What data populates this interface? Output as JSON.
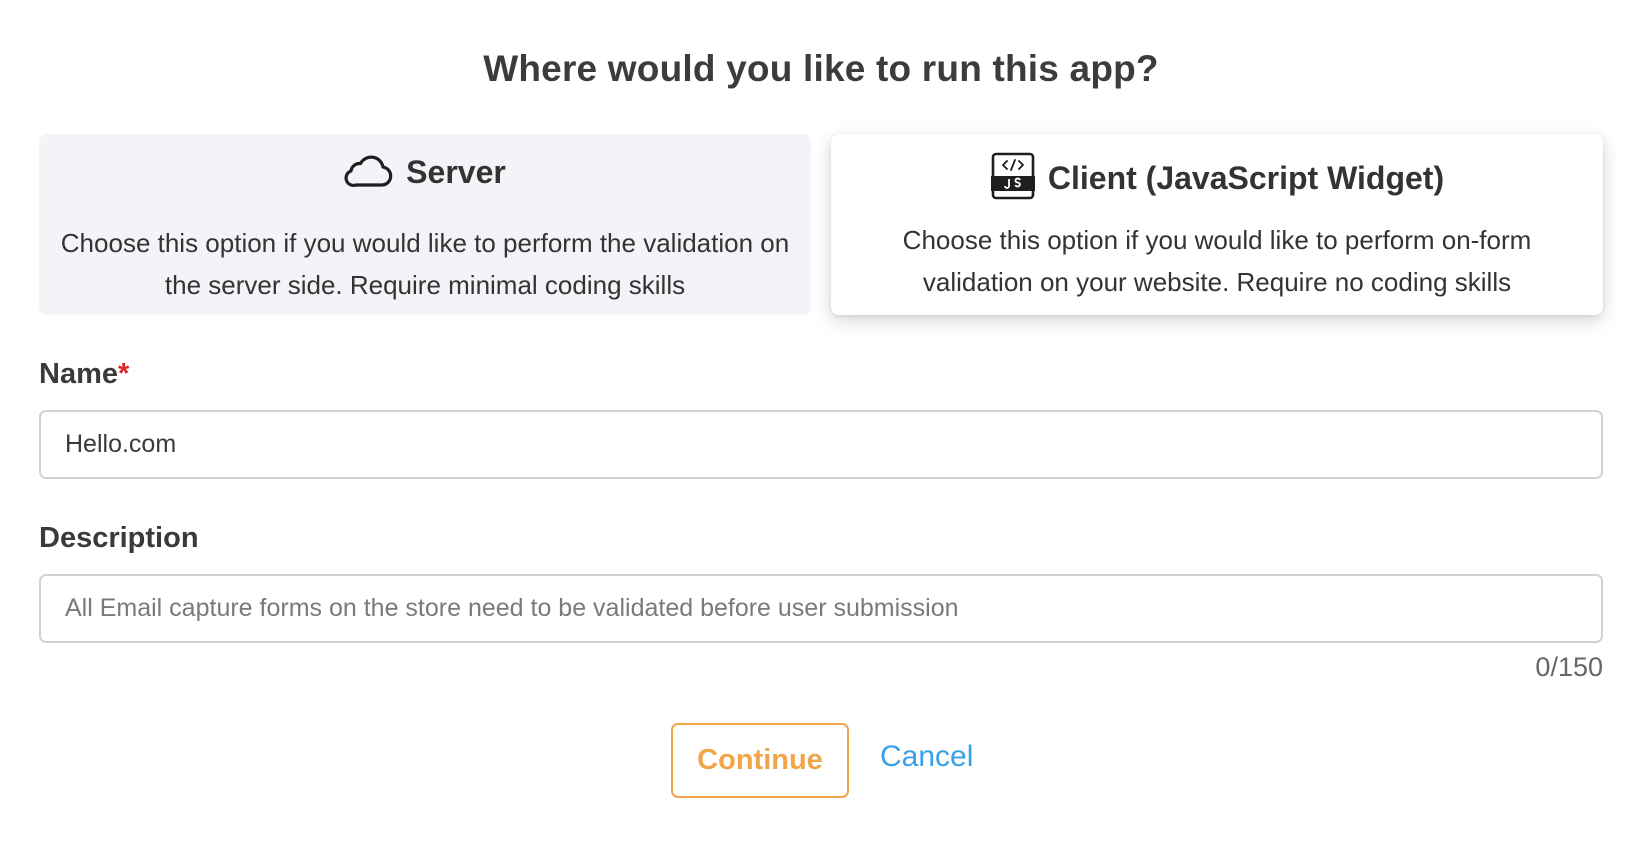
{
  "dialog": {
    "title": "Where would you like to run this app?"
  },
  "options": {
    "server": {
      "icon": "cloud-icon",
      "title": "Server",
      "description": "Choose this option if you would like to perform the validation on the server side. Require minimal coding skills"
    },
    "client": {
      "icon": "js-code-icon",
      "title": "Client (JavaScript Widget)",
      "description": "Choose this option if you would like to perform on-form validation on your website. Require no coding skills",
      "selected": true
    }
  },
  "form": {
    "name_label": "Name",
    "name_required_mark": "*",
    "name_value": "Hello.com",
    "description_label": "Description",
    "description_placeholder": "All Email capture forms on the store need to be validated before user submission",
    "description_value": "",
    "char_count": "0/150"
  },
  "actions": {
    "continue_label": "Continue",
    "cancel_label": "Cancel"
  },
  "colors": {
    "accent_orange": "#f0a54a",
    "link_blue": "#3aa0e6",
    "required_red": "#e02424",
    "server_card_bg": "#f3f4f7"
  }
}
